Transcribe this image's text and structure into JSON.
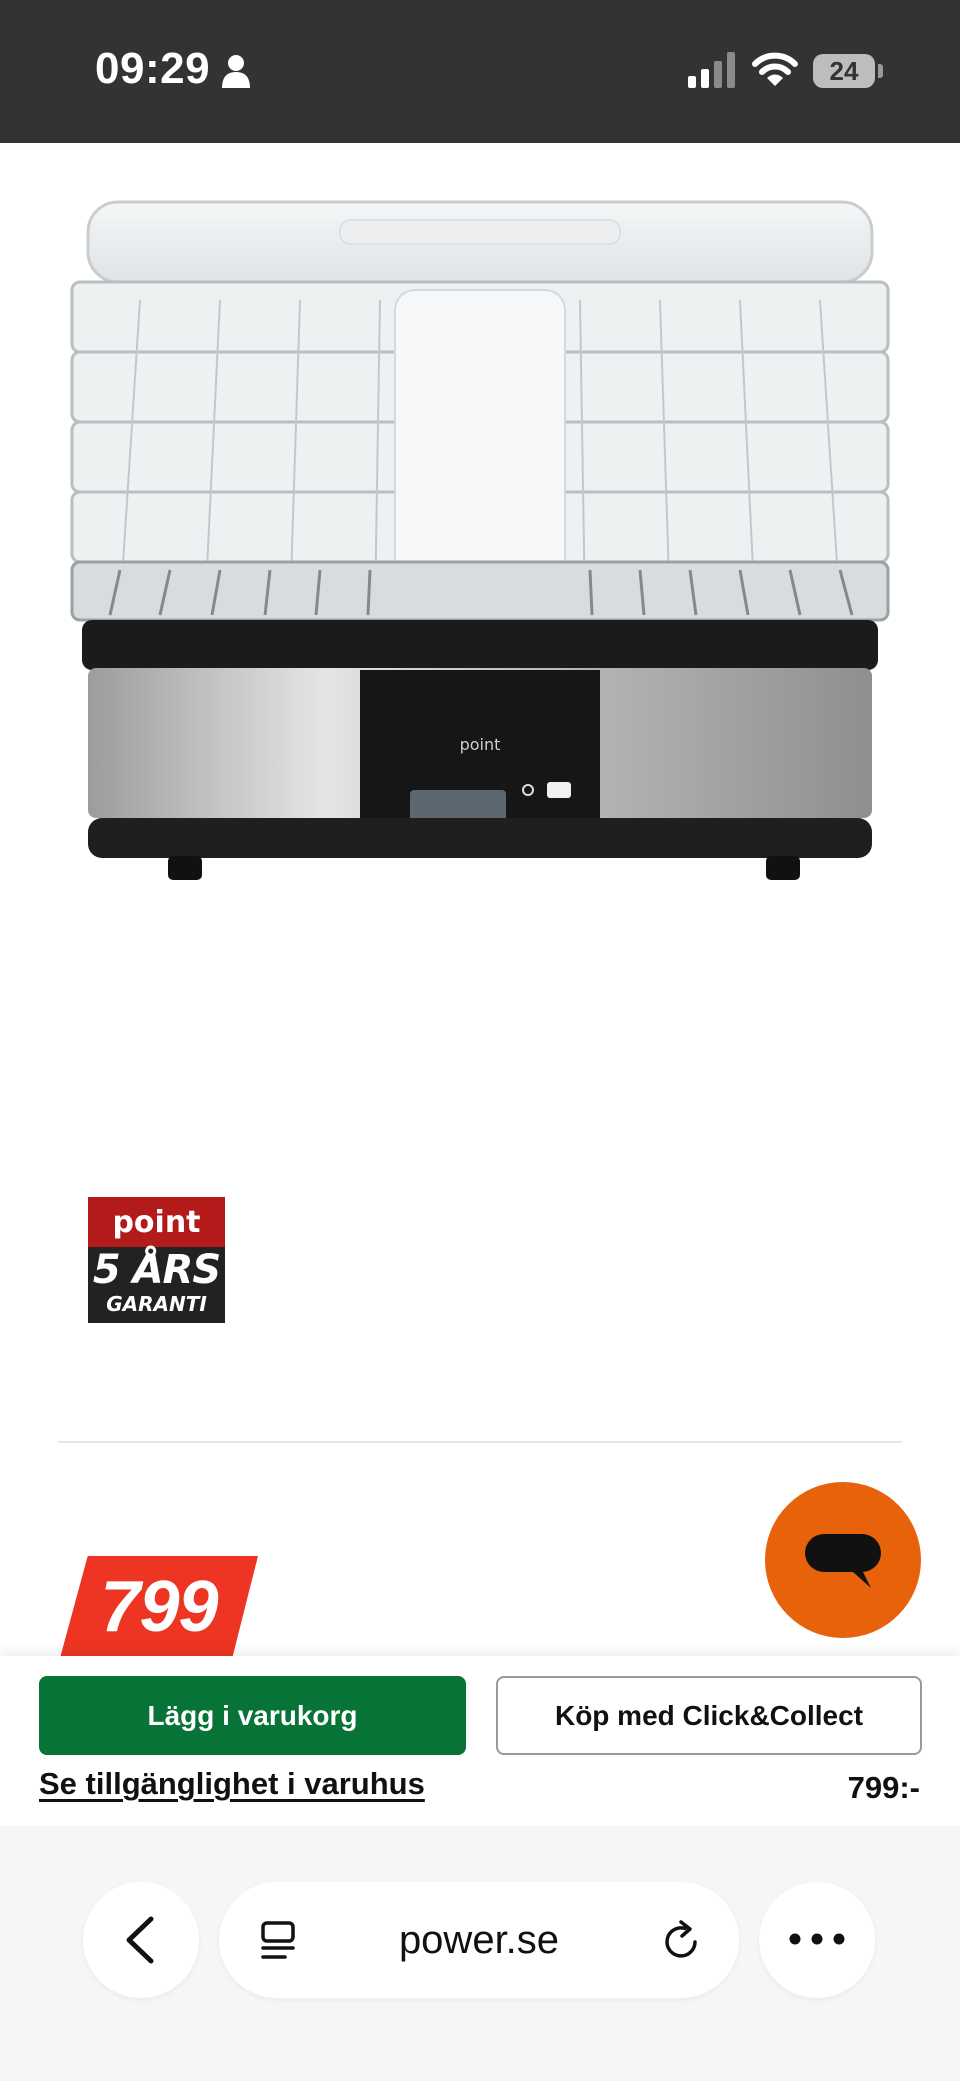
{
  "status_bar": {
    "time": "09:29",
    "battery": "24",
    "icons": [
      "person-icon",
      "signal-icon",
      "wifi-icon",
      "battery-icon"
    ]
  },
  "product": {
    "image": "food-dehydrator-product-image",
    "brand_on_device": "point",
    "badge": {
      "brand": "point",
      "years": "5 ÅRS",
      "garanti": "GARANTI"
    },
    "price_tag": "799"
  },
  "actions": {
    "add_to_cart": "Lägg i varukorg",
    "click_collect": "Köp med Click&Collect",
    "store_availability": "Se tillgänglighet i varuhus",
    "price": "799:-"
  },
  "browser": {
    "url": "power.se",
    "icons": [
      "back-icon",
      "tabs-icon",
      "reload-icon",
      "more-icon"
    ]
  },
  "colors": {
    "status_bar_bg": "#333333",
    "add_to_cart_bg": "#087336",
    "price_tag_bg": "#ee3524",
    "chat_bg": "#e8620c",
    "badge_red": "#b31b1b",
    "badge_black": "#222222"
  }
}
